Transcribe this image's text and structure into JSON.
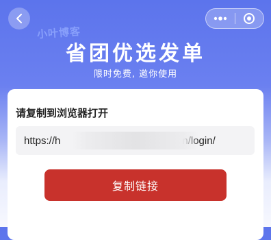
{
  "nav": {
    "back_icon": "chevron-left-icon",
    "more_icon": "more-dots-icon",
    "close_icon": "target-circle-icon"
  },
  "watermark_text": "小叶博客",
  "header": {
    "title": "省团优选发单",
    "subtitle": "限时免费, 邀你使用"
  },
  "card": {
    "label": "请复制到浏览器打开",
    "url_visible_prefix": "https://h",
    "url_visible_suffix": "n/login/",
    "copy_button_label": "复制链接"
  },
  "colors": {
    "header_blue": "#5c74ec",
    "button_red": "#c8322c",
    "url_box_bg": "#f3f3f5"
  }
}
